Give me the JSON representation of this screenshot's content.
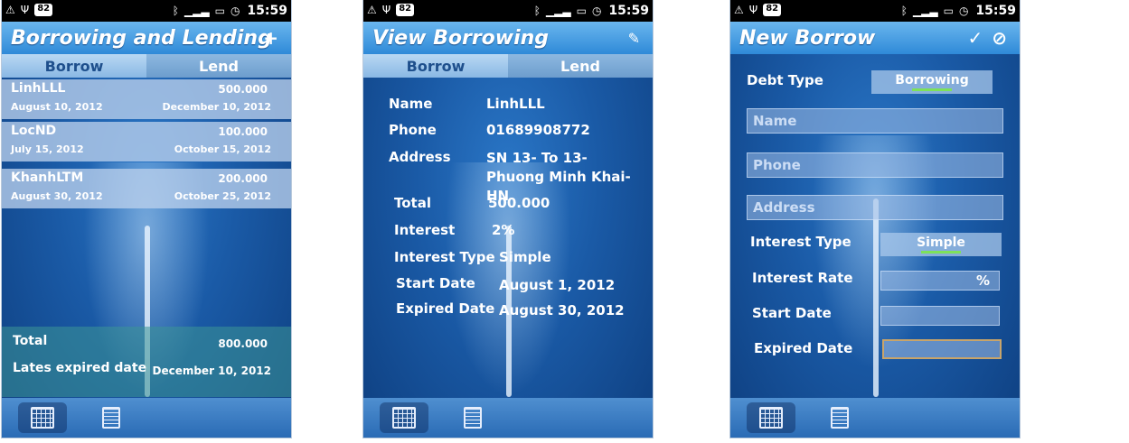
{
  "status": {
    "battery": "82",
    "time": "15:59"
  },
  "screen1": {
    "title": "Borrowing and Lending",
    "tabs": [
      "Borrow",
      "Lend"
    ],
    "rows": [
      {
        "name": "LinhLLL",
        "amount": "500.000",
        "date": "August 10, 2012",
        "due": "December 10, 2012"
      },
      {
        "name": "LocND",
        "amount": "100.000",
        "date": "July 15, 2012",
        "due": "October 15, 2012"
      },
      {
        "name": "KhanhLTM",
        "amount": "200.000",
        "date": "August 30, 2012",
        "due": "October 25, 2012"
      }
    ],
    "total_label": "Total",
    "total_value": "800.000",
    "latest_label": "Lates expired date",
    "latest_value": "December 10, 2012"
  },
  "screen2": {
    "title": "View Borrowing",
    "tabs": [
      "Borrow",
      "Lend"
    ],
    "fields": [
      {
        "label": "Name",
        "value": "LinhLLL"
      },
      {
        "label": "Phone",
        "value": "01689908772"
      },
      {
        "label": "Address",
        "value": "SN 13- To 13- Phuong Minh Khai- HN"
      },
      {
        "label": "Total",
        "value": "500.000"
      },
      {
        "label": "Interest",
        "value": "2%"
      },
      {
        "label": "Interest Type",
        "value": "Simple"
      },
      {
        "label": "Start Date",
        "value": "August 1, 2012"
      },
      {
        "label": "Expired Date",
        "value": "August 30, 2012"
      }
    ]
  },
  "screen3": {
    "title": "New Borrow",
    "debt_type_label": "Debt Type",
    "debt_type_value": "Borrowing",
    "name_placeholder": "Name",
    "phone_placeholder": "Phone",
    "address_placeholder": "Address",
    "interest_type_label": "Interest Type",
    "interest_type_value": "Simple",
    "interest_rate_label": "Interest Rate",
    "interest_rate_unit": "%",
    "start_date_label": "Start Date",
    "expired_date_label": "Expired Date"
  }
}
